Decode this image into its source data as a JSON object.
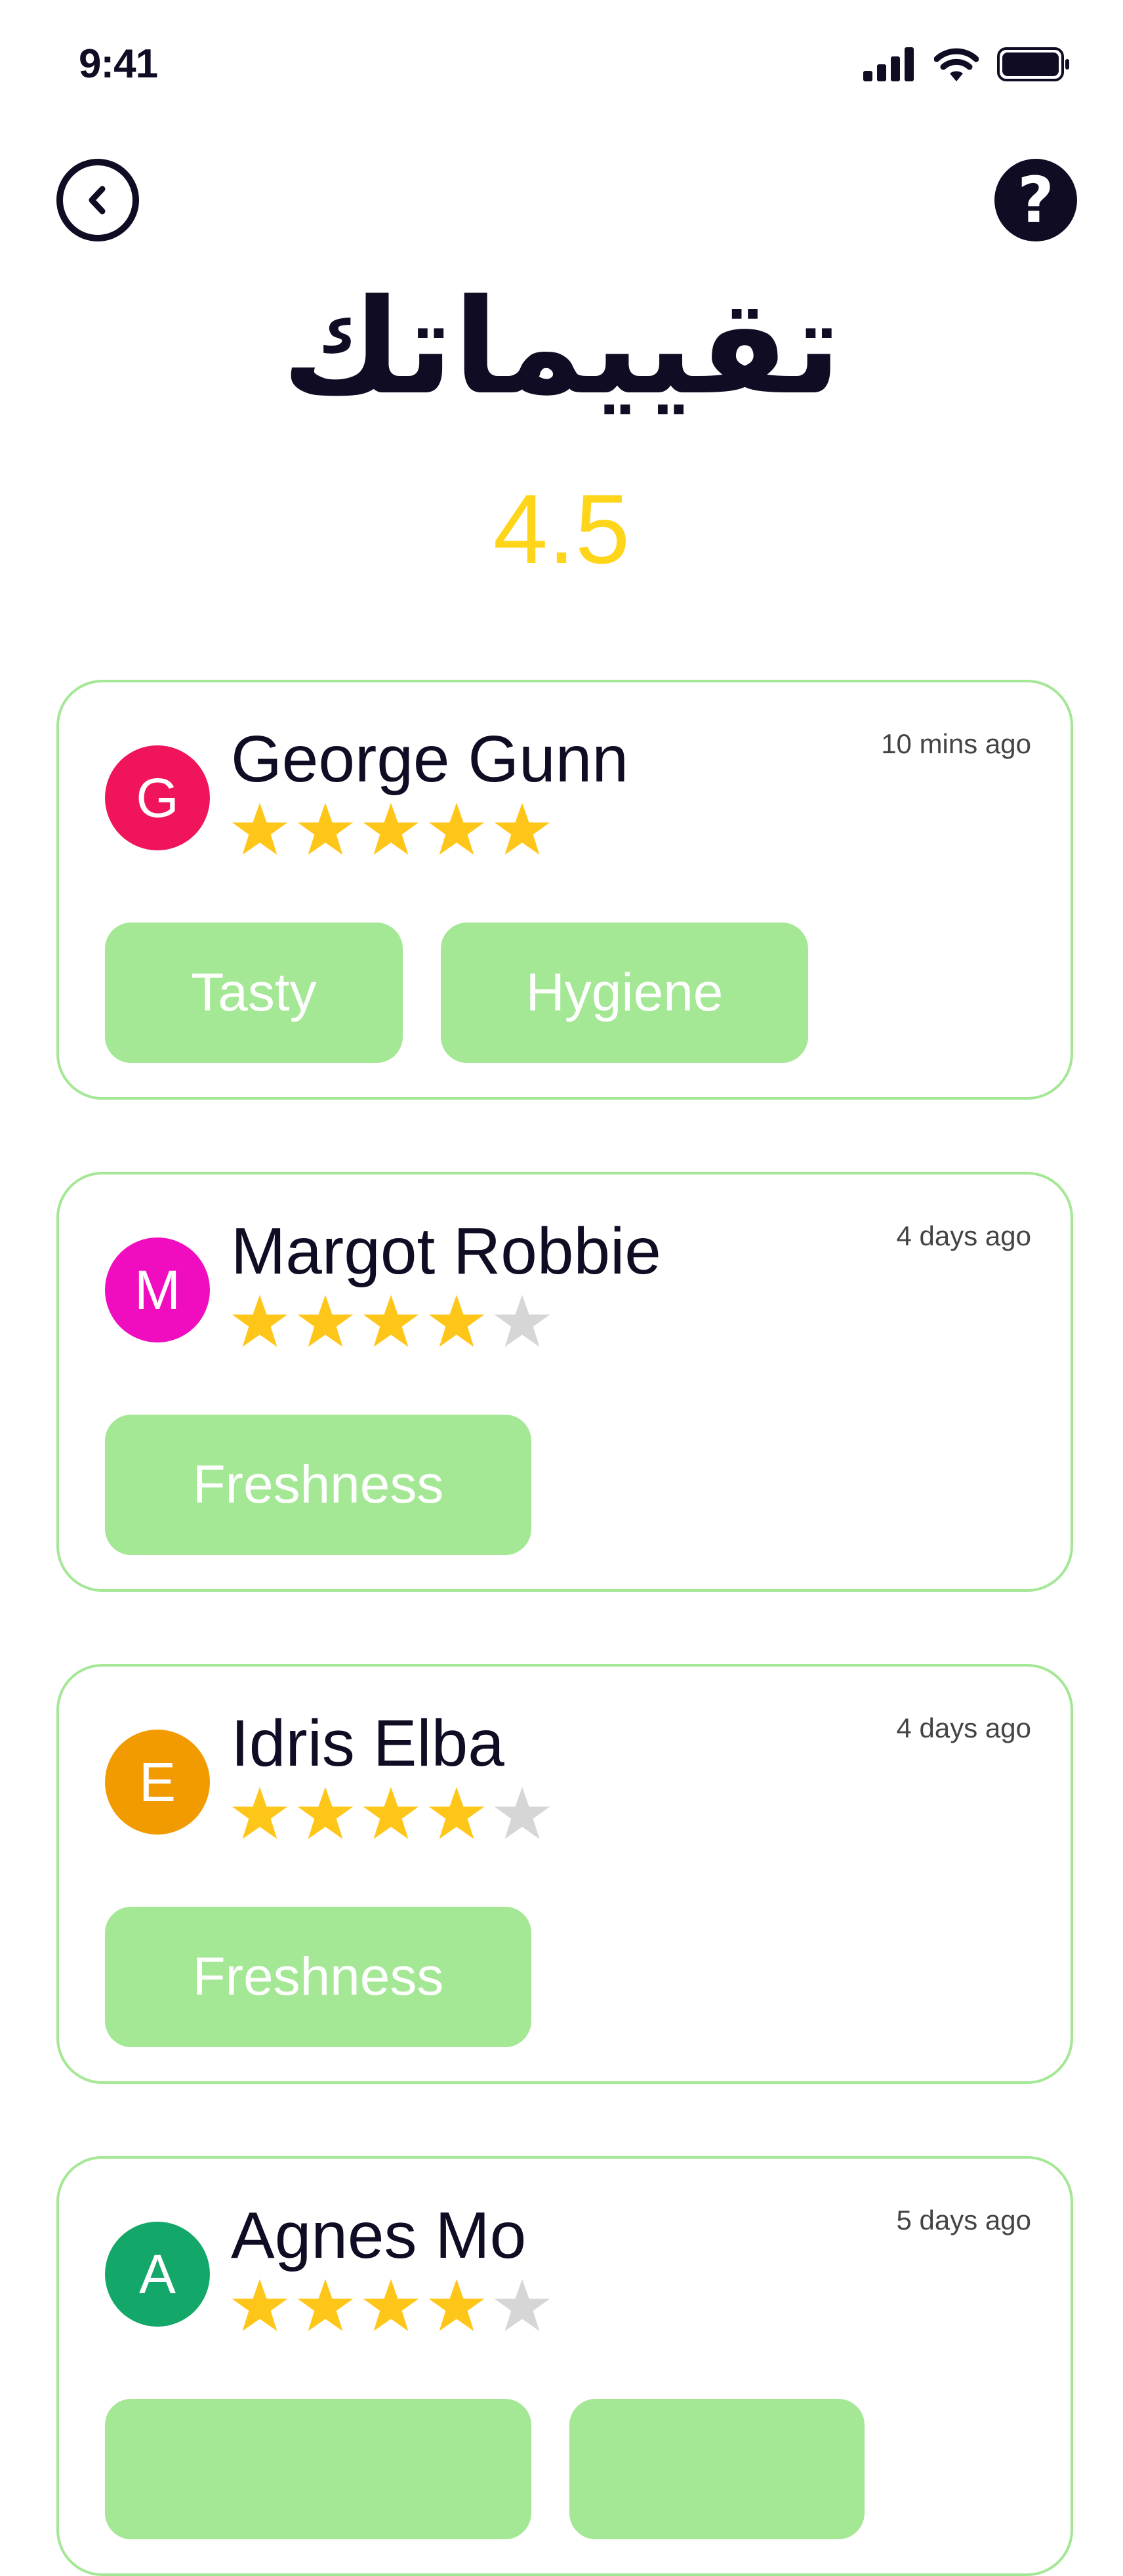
{
  "status_bar": {
    "time": "9:41"
  },
  "header": {
    "title": "تقييماتك",
    "average_rating": "4.5"
  },
  "colors": {
    "star_filled": "#ffc61a",
    "star_empty": "#d6d6d6",
    "tag_bg": "#a4e795",
    "card_border": "#a4e795"
  },
  "reviews": [
    {
      "initial": "G",
      "avatar_color": "#f0145a",
      "name": "George Gunn",
      "time": "10 mins ago",
      "rating": 5,
      "tags": [
        "Tasty",
        "Hygiene"
      ]
    },
    {
      "initial": "M",
      "avatar_color": "#f00dbf",
      "name": "Margot Robbie",
      "time": "4 days ago",
      "rating": 4,
      "tags": [
        "Freshness"
      ]
    },
    {
      "initial": "E",
      "avatar_color": "#f29b00",
      "name": "Idris Elba",
      "time": "4 days ago",
      "rating": 4,
      "tags": [
        "Freshness"
      ]
    },
    {
      "initial": "A",
      "avatar_color": "#13a86a",
      "name": "Agnes Mo",
      "time": "5 days ago",
      "rating": 4,
      "tags": [
        "",
        ""
      ]
    }
  ]
}
